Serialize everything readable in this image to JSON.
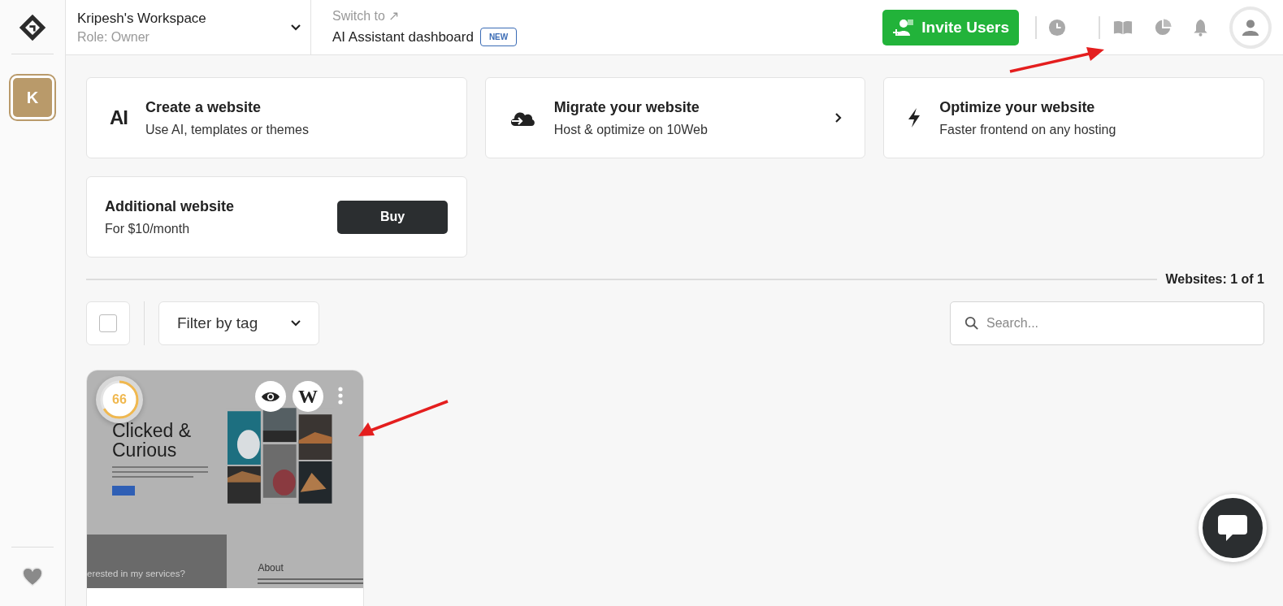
{
  "workspace": {
    "name": "Kripesh's Workspace",
    "role": "Role: Owner"
  },
  "switch": {
    "label": "Switch to ↗",
    "target": "AI Assistant dashboard",
    "badge": "NEW"
  },
  "invite_button": "Invite Users",
  "avatar_letter": "K",
  "action_cards": [
    {
      "kind": "ai",
      "icon_text": "AI",
      "title": "Create a website",
      "subtitle": "Use AI, templates or themes",
      "has_chevron": false
    },
    {
      "kind": "migrate",
      "title": "Migrate your website",
      "subtitle": "Host & optimize on 10Web",
      "has_chevron": true
    },
    {
      "kind": "optimize",
      "title": "Optimize your website",
      "subtitle": "Faster frontend on any hosting",
      "has_chevron": false
    }
  ],
  "addon": {
    "title": "Additional website",
    "subtitle": "For $10/month",
    "button": "Buy"
  },
  "websites_count": "Websites: 1 of 1",
  "select_all": {
    "checked": false
  },
  "filter": {
    "label": "Filter by tag"
  },
  "search": {
    "placeholder": "Search..."
  },
  "sites": [
    {
      "score": "66",
      "level": 0.66,
      "wp_label": "W",
      "preview": {
        "headline": "Clicked & Curious",
        "banner_text": "erested in my services?",
        "section_heading": "About"
      }
    }
  ]
}
